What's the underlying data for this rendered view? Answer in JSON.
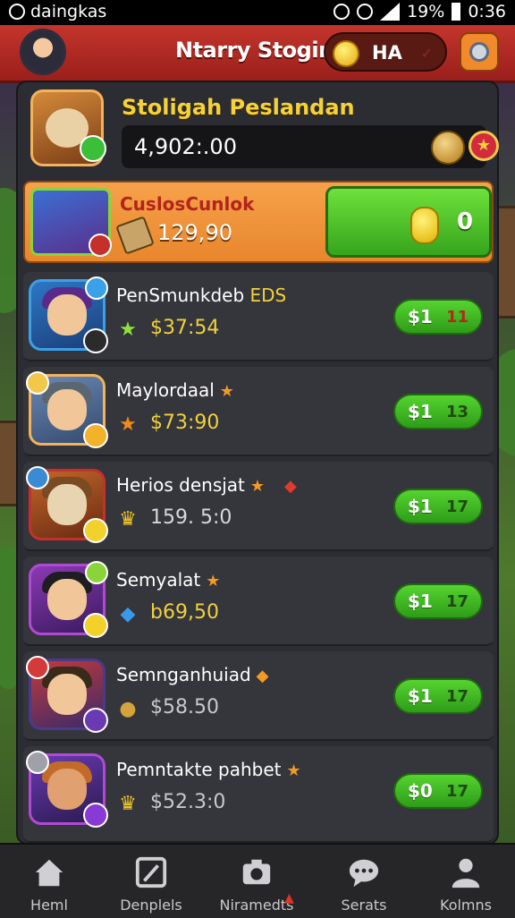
{
  "status_bar": {
    "app": "daingkas",
    "battery": "19%",
    "time": "0:36"
  },
  "top_bar": {
    "title": "Ntarry Stogin",
    "currency": "HA"
  },
  "header_card": {
    "title": "Stoligah Peslandan",
    "balance": "4,902:.00"
  },
  "featured": {
    "name": "CuslosCunlok",
    "price": "129,90",
    "button_amount": "0"
  },
  "rows": [
    {
      "name": "PenSmunkdeb",
      "name_suffix": "EDS",
      "star": "",
      "extra_star": "",
      "price": "$37:54",
      "price_icon": "star-icon",
      "btn_left": "$1",
      "btn_right": "11",
      "price_color": "#f0d23a",
      "btn_right_color": "#b22a1a"
    },
    {
      "name": "Maylordaal",
      "name_suffix": "",
      "star": "★",
      "extra_star": "",
      "price": "$73:90",
      "price_icon": "star-icon",
      "btn_left": "$1",
      "btn_right": "13",
      "price_color": "#f0d23a",
      "btn_right_color": "#1f4a12"
    },
    {
      "name": "Herios densjat",
      "name_suffix": "",
      "star": "★",
      "extra_star": "◆",
      "price": "159. 5:0",
      "price_icon": "crown-icon",
      "btn_left": "$1",
      "btn_right": "17",
      "price_color": "#d9d9d9",
      "btn_right_color": "#1f4a12"
    },
    {
      "name": "Semyalat",
      "name_suffix": "",
      "star": "★",
      "extra_star": "",
      "price": "b69,50",
      "price_icon": "gem-icon",
      "btn_left": "$1",
      "btn_right": "17",
      "price_color": "#f0d23a",
      "btn_right_color": "#1f4a12"
    },
    {
      "name": "Semnganhuiad",
      "name_suffix": "",
      "star": "◆",
      "extra_star": "",
      "price": "$58.50",
      "price_icon": "coin-icon",
      "btn_left": "$1",
      "btn_right": "17",
      "price_color": "#c9c9c9",
      "btn_right_color": "#1f4a12"
    },
    {
      "name": "Pemntakte pahbet",
      "name_suffix": "",
      "star": "★",
      "extra_star": "",
      "price": "$52.3:0",
      "price_icon": "crown-icon",
      "btn_left": "$0",
      "btn_right": "17",
      "price_color": "#c9c9c9",
      "btn_right_color": "#1f4a12"
    }
  ],
  "bottom_nav": [
    {
      "label": "Heml",
      "icon": "home-icon"
    },
    {
      "label": "Denplels",
      "icon": "edit-icon"
    },
    {
      "label": "Niramedts",
      "icon": "camera-icon"
    },
    {
      "label": "Serats",
      "icon": "chat-icon"
    },
    {
      "label": "Kolmns",
      "icon": "person-icon"
    }
  ]
}
